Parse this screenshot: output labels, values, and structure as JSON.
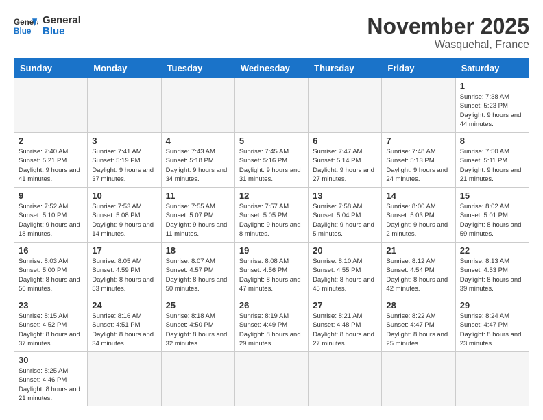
{
  "logo": {
    "general": "General",
    "blue": "Blue"
  },
  "title": "November 2025",
  "location": "Wasquehal, France",
  "weekdays": [
    "Sunday",
    "Monday",
    "Tuesday",
    "Wednesday",
    "Thursday",
    "Friday",
    "Saturday"
  ],
  "days": [
    {
      "num": "",
      "info": ""
    },
    {
      "num": "",
      "info": ""
    },
    {
      "num": "",
      "info": ""
    },
    {
      "num": "",
      "info": ""
    },
    {
      "num": "",
      "info": ""
    },
    {
      "num": "",
      "info": ""
    },
    {
      "num": "1",
      "info": "Sunrise: 7:38 AM\nSunset: 5:23 PM\nDaylight: 9 hours\nand 44 minutes."
    }
  ],
  "week2": [
    {
      "num": "2",
      "info": "Sunrise: 7:40 AM\nSunset: 5:21 PM\nDaylight: 9 hours\nand 41 minutes."
    },
    {
      "num": "3",
      "info": "Sunrise: 7:41 AM\nSunset: 5:19 PM\nDaylight: 9 hours\nand 37 minutes."
    },
    {
      "num": "4",
      "info": "Sunrise: 7:43 AM\nSunset: 5:18 PM\nDaylight: 9 hours\nand 34 minutes."
    },
    {
      "num": "5",
      "info": "Sunrise: 7:45 AM\nSunset: 5:16 PM\nDaylight: 9 hours\nand 31 minutes."
    },
    {
      "num": "6",
      "info": "Sunrise: 7:47 AM\nSunset: 5:14 PM\nDaylight: 9 hours\nand 27 minutes."
    },
    {
      "num": "7",
      "info": "Sunrise: 7:48 AM\nSunset: 5:13 PM\nDaylight: 9 hours\nand 24 minutes."
    },
    {
      "num": "8",
      "info": "Sunrise: 7:50 AM\nSunset: 5:11 PM\nDaylight: 9 hours\nand 21 minutes."
    }
  ],
  "week3": [
    {
      "num": "9",
      "info": "Sunrise: 7:52 AM\nSunset: 5:10 PM\nDaylight: 9 hours\nand 18 minutes."
    },
    {
      "num": "10",
      "info": "Sunrise: 7:53 AM\nSunset: 5:08 PM\nDaylight: 9 hours\nand 14 minutes."
    },
    {
      "num": "11",
      "info": "Sunrise: 7:55 AM\nSunset: 5:07 PM\nDaylight: 9 hours\nand 11 minutes."
    },
    {
      "num": "12",
      "info": "Sunrise: 7:57 AM\nSunset: 5:05 PM\nDaylight: 9 hours\nand 8 minutes."
    },
    {
      "num": "13",
      "info": "Sunrise: 7:58 AM\nSunset: 5:04 PM\nDaylight: 9 hours\nand 5 minutes."
    },
    {
      "num": "14",
      "info": "Sunrise: 8:00 AM\nSunset: 5:03 PM\nDaylight: 9 hours\nand 2 minutes."
    },
    {
      "num": "15",
      "info": "Sunrise: 8:02 AM\nSunset: 5:01 PM\nDaylight: 8 hours\nand 59 minutes."
    }
  ],
  "week4": [
    {
      "num": "16",
      "info": "Sunrise: 8:03 AM\nSunset: 5:00 PM\nDaylight: 8 hours\nand 56 minutes."
    },
    {
      "num": "17",
      "info": "Sunrise: 8:05 AM\nSunset: 4:59 PM\nDaylight: 8 hours\nand 53 minutes."
    },
    {
      "num": "18",
      "info": "Sunrise: 8:07 AM\nSunset: 4:57 PM\nDaylight: 8 hours\nand 50 minutes."
    },
    {
      "num": "19",
      "info": "Sunrise: 8:08 AM\nSunset: 4:56 PM\nDaylight: 8 hours\nand 47 minutes."
    },
    {
      "num": "20",
      "info": "Sunrise: 8:10 AM\nSunset: 4:55 PM\nDaylight: 8 hours\nand 45 minutes."
    },
    {
      "num": "21",
      "info": "Sunrise: 8:12 AM\nSunset: 4:54 PM\nDaylight: 8 hours\nand 42 minutes."
    },
    {
      "num": "22",
      "info": "Sunrise: 8:13 AM\nSunset: 4:53 PM\nDaylight: 8 hours\nand 39 minutes."
    }
  ],
  "week5": [
    {
      "num": "23",
      "info": "Sunrise: 8:15 AM\nSunset: 4:52 PM\nDaylight: 8 hours\nand 37 minutes."
    },
    {
      "num": "24",
      "info": "Sunrise: 8:16 AM\nSunset: 4:51 PM\nDaylight: 8 hours\nand 34 minutes."
    },
    {
      "num": "25",
      "info": "Sunrise: 8:18 AM\nSunset: 4:50 PM\nDaylight: 8 hours\nand 32 minutes."
    },
    {
      "num": "26",
      "info": "Sunrise: 8:19 AM\nSunset: 4:49 PM\nDaylight: 8 hours\nand 29 minutes."
    },
    {
      "num": "27",
      "info": "Sunrise: 8:21 AM\nSunset: 4:48 PM\nDaylight: 8 hours\nand 27 minutes."
    },
    {
      "num": "28",
      "info": "Sunrise: 8:22 AM\nSunset: 4:47 PM\nDaylight: 8 hours\nand 25 minutes."
    },
    {
      "num": "29",
      "info": "Sunrise: 8:24 AM\nSunset: 4:47 PM\nDaylight: 8 hours\nand 23 minutes."
    }
  ],
  "week6": [
    {
      "num": "30",
      "info": "Sunrise: 8:25 AM\nSunset: 4:46 PM\nDaylight: 8 hours\nand 21 minutes."
    },
    {
      "num": "",
      "info": ""
    },
    {
      "num": "",
      "info": ""
    },
    {
      "num": "",
      "info": ""
    },
    {
      "num": "",
      "info": ""
    },
    {
      "num": "",
      "info": ""
    },
    {
      "num": "",
      "info": ""
    }
  ]
}
